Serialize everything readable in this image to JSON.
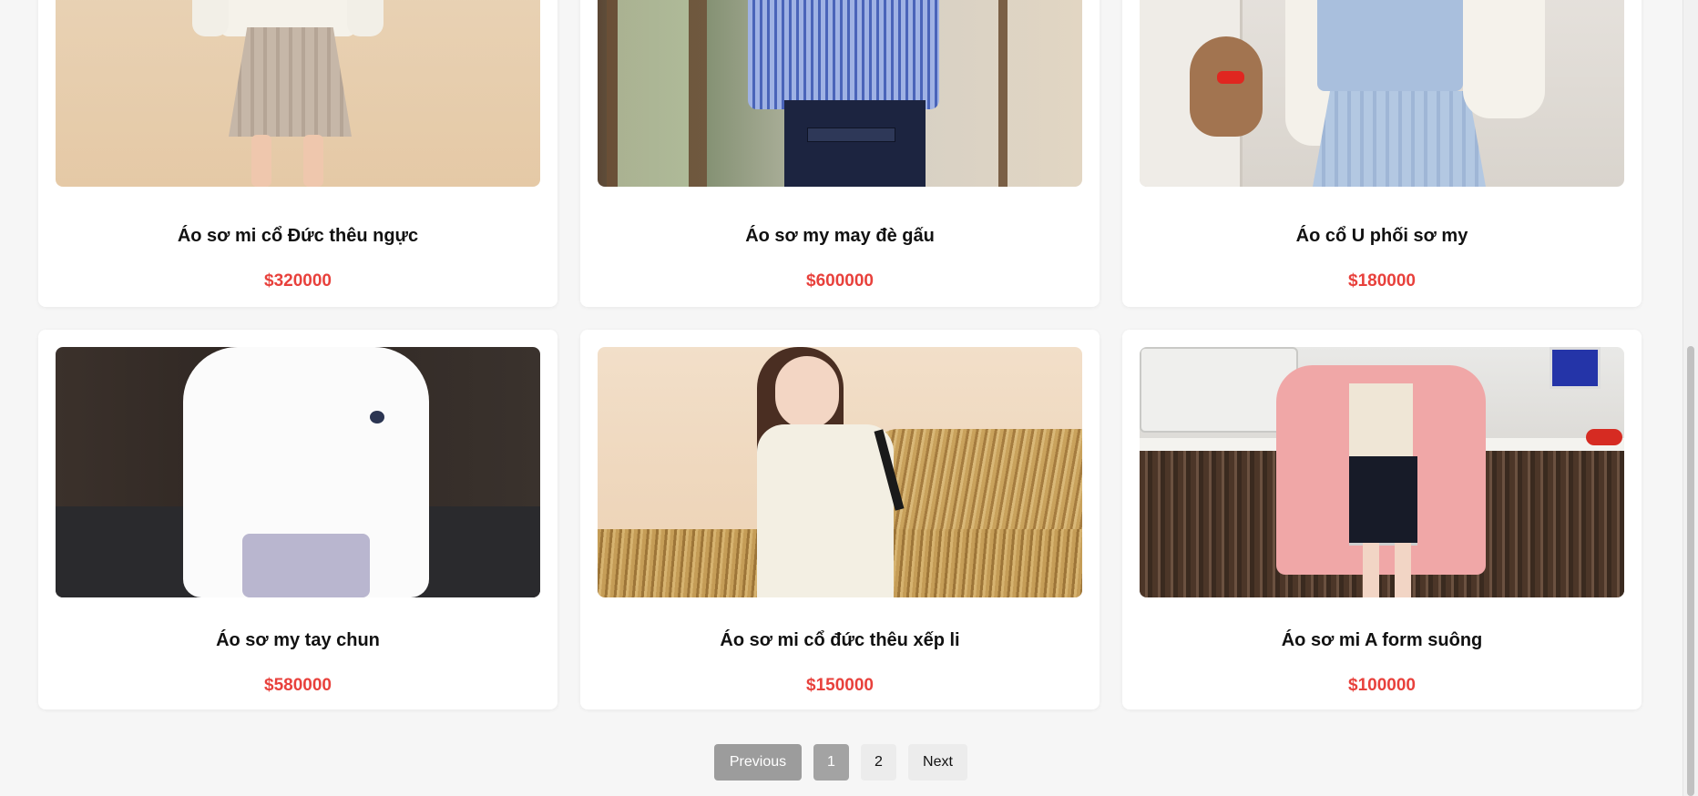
{
  "products": [
    {
      "name": "Áo sơ mi cổ Đức thêu ngực",
      "price": "$320000",
      "image": "woman-white-blouse-pleated-skirt"
    },
    {
      "name": "Áo sơ my may đè gấu",
      "price": "$600000",
      "image": "blue-striped-shirt-denim"
    },
    {
      "name": "Áo cổ U phối sơ my",
      "price": "$180000",
      "image": "blue-vest-teddy-bear"
    },
    {
      "name": "Áo sơ my tay chun",
      "price": "$580000",
      "image": "white-shirt-lavender-skirt"
    },
    {
      "name": "Áo sơ mi cổ đức thêu xếp li",
      "price": "$150000",
      "image": "girl-cream-blouse-hay"
    },
    {
      "name": "Áo sơ mi A form suông",
      "price": "$100000",
      "image": "pink-shirt-cafe-counter"
    }
  ],
  "pagination": {
    "previous": "Previous",
    "pages": [
      "1",
      "2"
    ],
    "current": "1",
    "next": "Next"
  },
  "colors": {
    "price": "#e8413c",
    "background": "#f6f6f6"
  }
}
